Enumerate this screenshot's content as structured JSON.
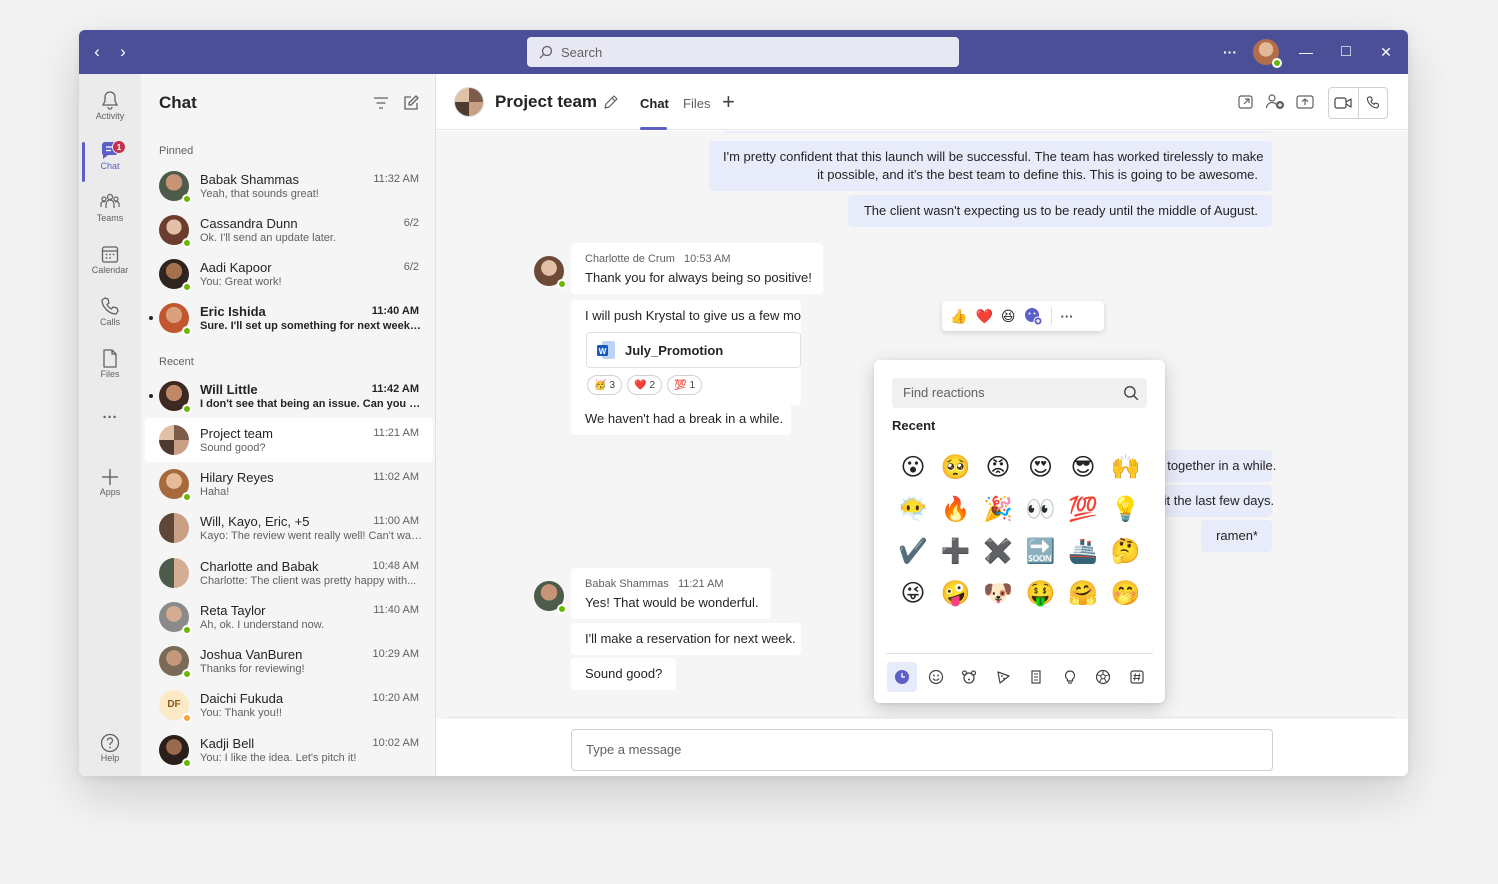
{
  "window": {
    "search_placeholder": "Search",
    "more_label": "···",
    "minimize_label": "—",
    "maximize_label": "□",
    "close_label": "✕",
    "back_label": "‹",
    "forward_label": "›"
  },
  "rail": {
    "items": [
      {
        "label": "Activity",
        "icon": "bell-icon"
      },
      {
        "label": "Chat",
        "icon": "chat-icon",
        "badge": "1"
      },
      {
        "label": "Teams",
        "icon": "teams-icon"
      },
      {
        "label": "Calendar",
        "icon": "calendar-icon"
      },
      {
        "label": "Calls",
        "icon": "phone-icon"
      },
      {
        "label": "Files",
        "icon": "file-icon"
      },
      {
        "label": "Apps",
        "icon": "plus-icon"
      },
      {
        "label": "Help",
        "icon": "help-icon"
      }
    ],
    "more_label": "···"
  },
  "chatlist": {
    "title": "Chat",
    "pinned_label": "Pinned",
    "recent_label": "Recent",
    "pinned": [
      {
        "name": "Babak Shammas",
        "preview": "Yeah, that sounds great!",
        "time": "11:32 AM"
      },
      {
        "name": "Cassandra Dunn",
        "preview": "Ok. I'll send an update later.",
        "time": "6/2"
      },
      {
        "name": "Aadi Kapoor",
        "preview": "You: Great work!",
        "time": "6/2"
      },
      {
        "name": "Eric Ishida",
        "preview": "Sure. I'll set up something for next week t...",
        "time": "11:40 AM"
      }
    ],
    "recent": [
      {
        "name": "Will Little",
        "preview": "I don't see that being an issue. Can you ta...",
        "time": "11:42 AM"
      },
      {
        "name": "Project team",
        "preview": "Sound good?",
        "time": "11:21 AM"
      },
      {
        "name": "Hilary Reyes",
        "preview": "Haha!",
        "time": "11:02 AM"
      },
      {
        "name": "Will, Kayo, Eric, +5",
        "preview": "Kayo: The review went really well! Can't wai...",
        "time": "11:00 AM"
      },
      {
        "name": "Charlotte and Babak",
        "preview": "Charlotte: The client was pretty happy with...",
        "time": "10:48 AM"
      },
      {
        "name": "Reta Taylor",
        "preview": "Ah, ok. I understand now.",
        "time": "11:40 AM"
      },
      {
        "name": "Joshua VanBuren",
        "preview": "Thanks for reviewing!",
        "time": "10:29 AM"
      },
      {
        "name": "Daichi Fukuda",
        "preview": "You: Thank you!!",
        "time": "10:20 AM",
        "initials": "DF"
      },
      {
        "name": "Kadji Bell",
        "preview": "You: I like the idea. Let's pitch it!",
        "time": "10:02 AM"
      }
    ]
  },
  "conversation": {
    "title": "Project team",
    "tabs": [
      "Chat",
      "Files"
    ],
    "add_tab": "+",
    "messages": {
      "mine1": "I'm pretty confident that this launch will be successful. The team has worked tirelessly to make",
      "mine1b": "it possible, and it's the best team to define this. This is going to be awesome.",
      "mine2": "The client wasn't expecting us to be ready until the middle of August.",
      "charlotte_name": "Charlotte de Crum",
      "charlotte_time": "10:53 AM",
      "charlotte1": "Thank you for always being so positive!",
      "charlotte2": "I will push Krystal to give us a few mo",
      "file_name": "July_Promotion",
      "reactions": [
        {
          "emoji": "🥳",
          "count": "3"
        },
        {
          "emoji": "❤️",
          "count": "2"
        },
        {
          "emoji": "💯",
          "count": "1"
        }
      ],
      "charlotte3": "We haven't had a break in a while.",
      "mine3": "otten lunch together in a while.",
      "mine4": "en craving it the last few days.",
      "mine5": "ramen*",
      "babak_name": "Babak Shammas",
      "babak_time": "11:21 AM",
      "babak1": "Yes! That would be wonderful.",
      "babak2": "I'll make a reservation for next week.",
      "babak3": "Sound good?"
    },
    "compose_placeholder": "Type a message"
  },
  "reaction_bar": [
    "👍",
    "❤️",
    "😆"
  ],
  "reactions_panel": {
    "search_placeholder": "Find reactions",
    "section": "Recent",
    "emojis": [
      "😮",
      "🥺",
      "😡",
      "😍",
      "😎",
      "🙌",
      "😶‍🌫️",
      "🔥",
      "🎉",
      "👀",
      "💯",
      "💡",
      "✔️",
      "➕",
      "✖️",
      "🔜",
      "🚢",
      "🤔",
      "😜",
      "🤪",
      "🐶",
      "🤑",
      "🤗",
      "🤭"
    ]
  },
  "colors": {
    "titlebar": "#4b4f97",
    "accent": "#5b5fc7",
    "presence_available": "#6bb700",
    "presence_away": "#f8a43a",
    "badge": "#c4314b"
  }
}
